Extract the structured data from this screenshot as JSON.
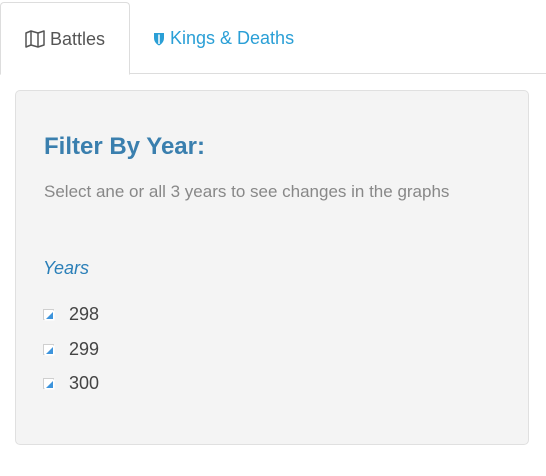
{
  "tabs": [
    {
      "label": "Battles",
      "icon": "map-icon",
      "active": true
    },
    {
      "label": "Kings & Deaths",
      "icon": "shield-icon",
      "active": false
    }
  ],
  "colors": {
    "accent": "#2a9fd6",
    "title": "#3a7fae",
    "panel_background": "#f4f4f4",
    "muted_text": "#888888"
  },
  "filter": {
    "title": "Filter By Year:",
    "help": "Select ane or all 3 years to see changes in the graphs",
    "years_label": "Years",
    "years": [
      {
        "value": "298",
        "checked": true
      },
      {
        "value": "299",
        "checked": true
      },
      {
        "value": "300",
        "checked": true
      }
    ]
  }
}
